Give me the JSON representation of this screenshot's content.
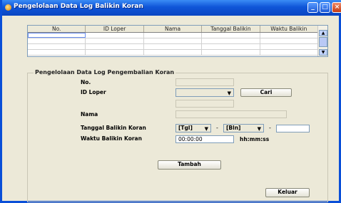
{
  "window": {
    "title": "Pengelolaan Data Log Balikin Koran",
    "min": "_",
    "max": "□",
    "close": "×"
  },
  "table": {
    "columns": [
      "No.",
      "ID Loper",
      "Nama",
      "Tanggal Balikin",
      "Waktu Balikin"
    ],
    "rows": [
      [
        "",
        "",
        "",
        "",
        ""
      ],
      [
        "",
        "",
        "",
        "",
        ""
      ],
      [
        "",
        "",
        "",
        "",
        ""
      ],
      [
        "",
        "",
        "",
        "",
        ""
      ]
    ],
    "scroll_up": "▲",
    "scroll_down": "▼"
  },
  "form": {
    "group_title": "Pengelolaan Data Log Pengembalian Koran",
    "no_label": "No.",
    "id_loper_label": "ID Loper",
    "id_loper_value": "",
    "cari_button": "Cari",
    "nama_label": "Nama",
    "tanggal_label": "Tanggal Balikin Koran",
    "tgl_select": "[Tgl]",
    "bln_select": "[Bln]",
    "dash": "-",
    "year_value": "",
    "waktu_label": "Waktu Balikin Koran",
    "waktu_value": "00:00:00",
    "waktu_hint": "hh:mm:ss",
    "tambah_button": "Tambah",
    "keluar_button": "Keluar",
    "combo_arrow": "▼"
  }
}
